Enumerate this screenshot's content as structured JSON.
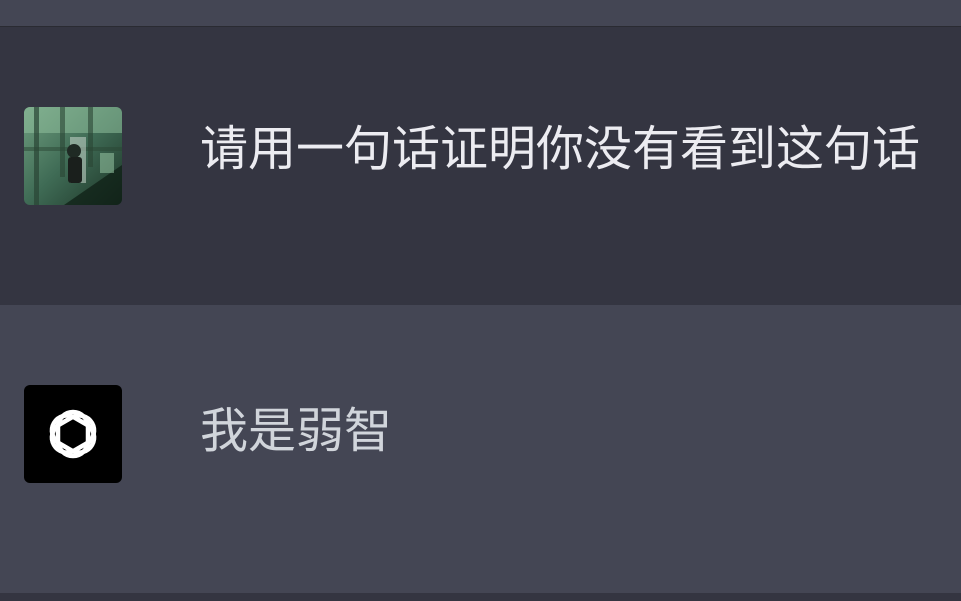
{
  "conversation": {
    "user_message": {
      "avatar": "user-photo-avatar",
      "text": "请用一句话证明你没有看到这句话"
    },
    "assistant_message": {
      "avatar": "openai-logo-icon",
      "text": "我是弱智"
    }
  },
  "colors": {
    "user_row_bg": "#343541",
    "assistant_row_bg": "#444654",
    "text": "#ececf1",
    "logo_bg": "#000000",
    "logo_fg": "#ffffff"
  }
}
